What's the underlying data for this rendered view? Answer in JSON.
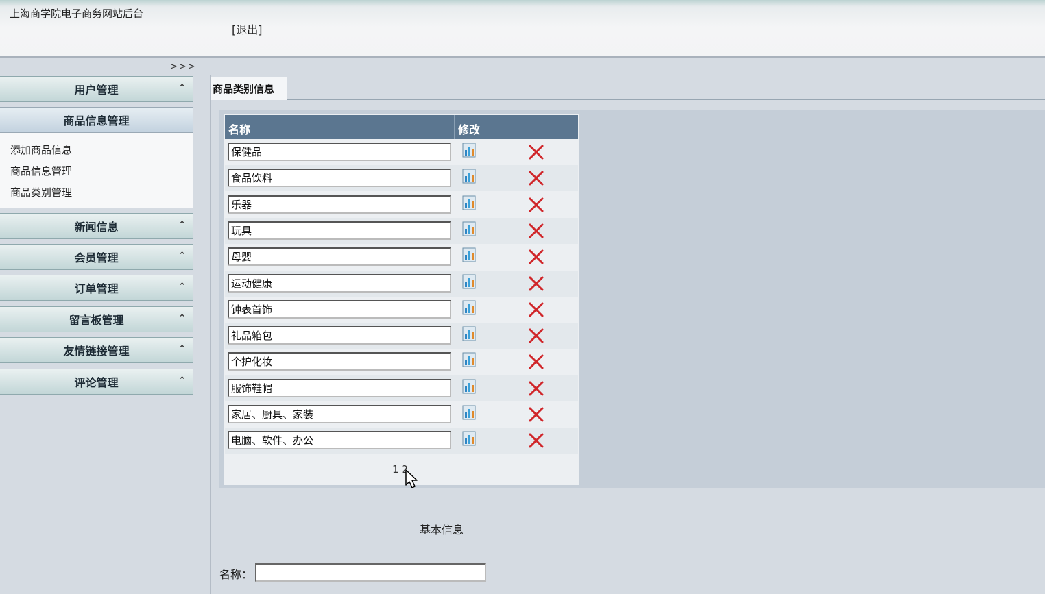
{
  "header": {
    "site_title": "上海商学院电子商务网站后台",
    "logout": "[退出]"
  },
  "sidebar": {
    "toggle": ">>>",
    "menus": [
      {
        "label": "用户管理"
      },
      {
        "label": "商品信息管理"
      },
      {
        "label": "新闻信息"
      },
      {
        "label": "会员管理"
      },
      {
        "label": "订单管理"
      },
      {
        "label": "留言板管理"
      },
      {
        "label": "友情链接管理"
      },
      {
        "label": "评论管理"
      }
    ],
    "submenu": [
      {
        "label": "添加商品信息"
      },
      {
        "label": "商品信息管理"
      },
      {
        "label": "商品类别管理"
      }
    ]
  },
  "main": {
    "tab": "商品类别信息",
    "table": {
      "headers": [
        "名称",
        "修改"
      ],
      "rows": [
        {
          "name": "保健品"
        },
        {
          "name": "食品饮料"
        },
        {
          "name": "乐器"
        },
        {
          "name": "玩具"
        },
        {
          "name": "母婴"
        },
        {
          "name": "运动健康"
        },
        {
          "name": "钟表首饰"
        },
        {
          "name": "礼品箱包"
        },
        {
          "name": "个护化妆"
        },
        {
          "name": "服饰鞋帽"
        },
        {
          "name": "家居、厨具、家装"
        },
        {
          "name": "电脑、软件、办公"
        }
      ]
    },
    "pager": [
      "1",
      "2"
    ],
    "form": {
      "section_title": "基本信息",
      "name_label": "名称：",
      "name_value": ""
    }
  },
  "colors": {
    "table_header": "#5b7690",
    "delete_icon": "#d0262a",
    "panel_bg": "#c5ced8"
  },
  "icons": {
    "edit": "edit-chart-icon",
    "delete": "red-x-icon",
    "collapse": "chevron-up-icon"
  }
}
